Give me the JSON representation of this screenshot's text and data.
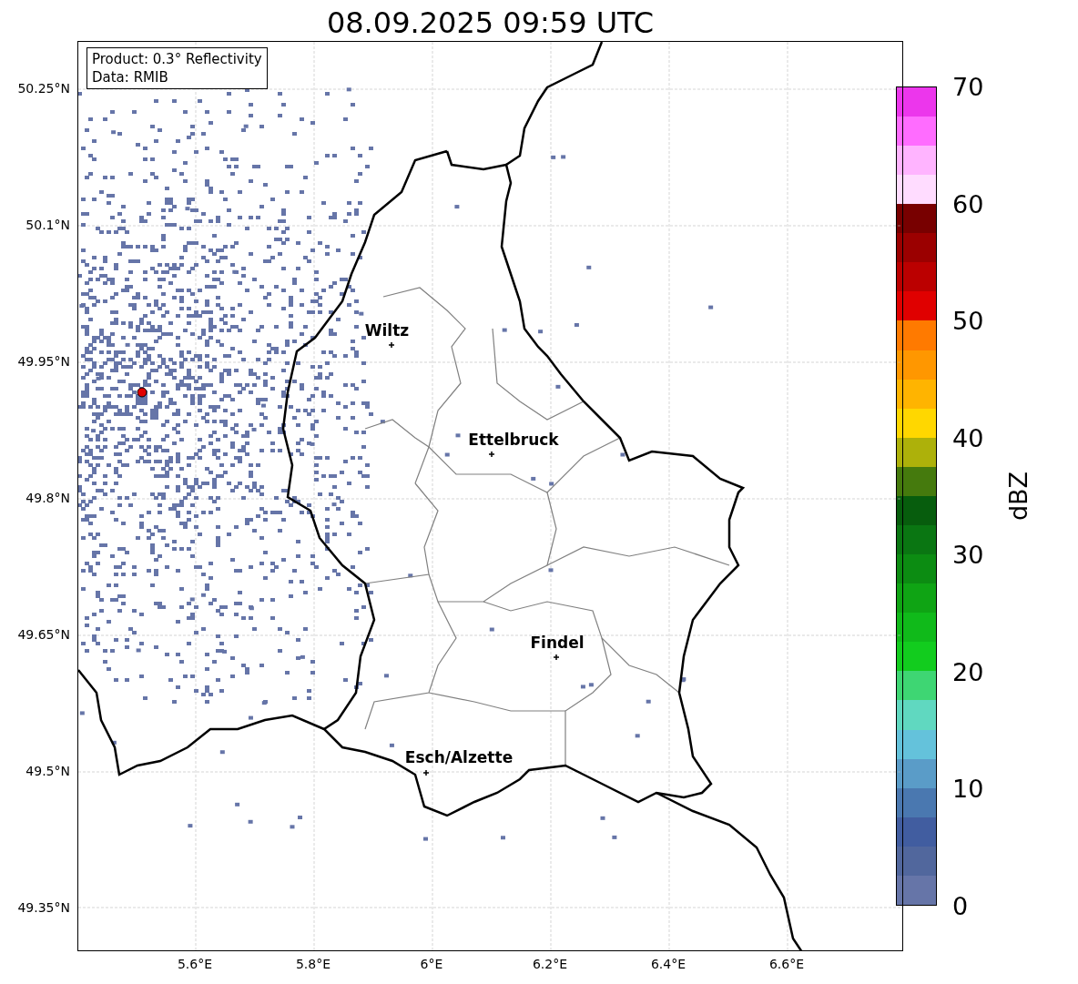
{
  "title": "08.09.2025 09:59 UTC",
  "info_box": {
    "lines": [
      "Product: 0.3° Reflectivity",
      "Data: RMIB"
    ]
  },
  "y_ticks": [
    "50.25°N",
    "50.1°N",
    "49.95°N",
    "49.8°N",
    "49.65°N",
    "49.5°N",
    "49.35°N"
  ],
  "x_ticks": [
    "5.6°E",
    "5.8°E",
    "6°E",
    "6.2°E",
    "6.4°E",
    "6.6°E"
  ],
  "cities": [
    {
      "name": "Wiltz"
    },
    {
      "name": "Ettelbruck"
    },
    {
      "name": "Findel"
    },
    {
      "name": "Esch/Alzette"
    }
  ],
  "colorbar": {
    "label": "dBZ",
    "ticks": [
      "70",
      "60",
      "50",
      "40",
      "30",
      "20",
      "10",
      "0"
    ],
    "segments": [
      {
        "color": "#6675a8"
      },
      {
        "color": "#51679d"
      },
      {
        "color": "#415da0"
      },
      {
        "color": "#4a78b0"
      },
      {
        "color": "#5a9cc8"
      },
      {
        "color": "#64c2db"
      },
      {
        "color": "#60d8c0"
      },
      {
        "color": "#3ed673"
      },
      {
        "color": "#12cc1e"
      },
      {
        "color": "#10ba1a"
      },
      {
        "color": "#0fa414"
      },
      {
        "color": "#0c8c12"
      },
      {
        "color": "#0a7612"
      },
      {
        "color": "#075d0d"
      },
      {
        "color": "#457a0d"
      },
      {
        "color": "#adb10a"
      },
      {
        "color": "#ffd700"
      },
      {
        "color": "#ffb400"
      },
      {
        "color": "#ff9700"
      },
      {
        "color": "#ff7a00"
      },
      {
        "color": "#e00000"
      },
      {
        "color": "#bb0000"
      },
      {
        "color": "#9b0000"
      },
      {
        "color": "#780000"
      },
      {
        "color": "#ffdcff"
      },
      {
        "color": "#ffb4ff"
      },
      {
        "color": "#ff6cff"
      },
      {
        "color": "#ec36ec"
      }
    ]
  }
}
